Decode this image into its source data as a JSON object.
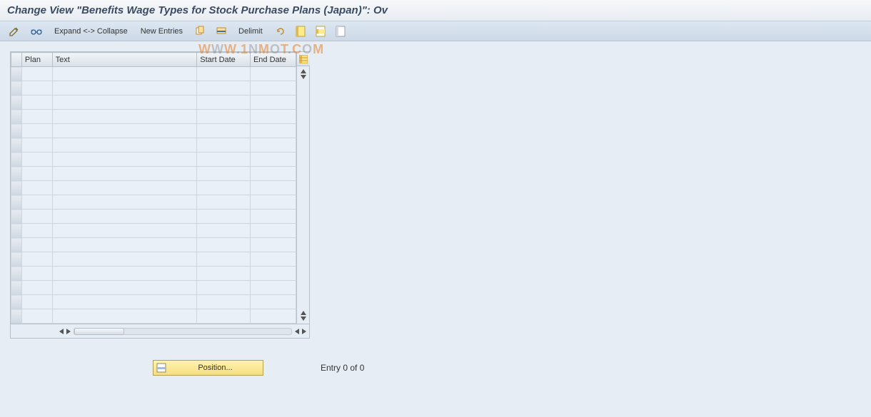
{
  "title": "Change View \"Benefits Wage Types for Stock Purchase Plans (Japan)\": Ov",
  "toolbar": {
    "expand_collapse": "Expand <-> Collapse",
    "new_entries": "New Entries",
    "delimit": "Delimit"
  },
  "columns": {
    "plan": "Plan",
    "text": "Text",
    "start_date": "Start Date",
    "end_date": "End Date"
  },
  "rows": [
    {
      "plan": "",
      "text": "",
      "start": "",
      "end": ""
    },
    {
      "plan": "",
      "text": "",
      "start": "",
      "end": ""
    },
    {
      "plan": "",
      "text": "",
      "start": "",
      "end": ""
    },
    {
      "plan": "",
      "text": "",
      "start": "",
      "end": ""
    },
    {
      "plan": "",
      "text": "",
      "start": "",
      "end": ""
    },
    {
      "plan": "",
      "text": "",
      "start": "",
      "end": ""
    },
    {
      "plan": "",
      "text": "",
      "start": "",
      "end": ""
    },
    {
      "plan": "",
      "text": "",
      "start": "",
      "end": ""
    },
    {
      "plan": "",
      "text": "",
      "start": "",
      "end": ""
    },
    {
      "plan": "",
      "text": "",
      "start": "",
      "end": ""
    },
    {
      "plan": "",
      "text": "",
      "start": "",
      "end": ""
    },
    {
      "plan": "",
      "text": "",
      "start": "",
      "end": ""
    },
    {
      "plan": "",
      "text": "",
      "start": "",
      "end": ""
    },
    {
      "plan": "",
      "text": "",
      "start": "",
      "end": ""
    },
    {
      "plan": "",
      "text": "",
      "start": "",
      "end": ""
    },
    {
      "plan": "",
      "text": "",
      "start": "",
      "end": ""
    },
    {
      "plan": "",
      "text": "",
      "start": "",
      "end": ""
    },
    {
      "plan": "",
      "text": "",
      "start": "",
      "end": ""
    }
  ],
  "position_button": "Position...",
  "entry_status": "Entry 0 of 0",
  "icons": {
    "toggle": "toggle-edit-icon",
    "other": "other-view-icon",
    "copy": "copy-icon",
    "delete": "delete-icon",
    "undo": "undo-icon",
    "select_all": "select-all-icon",
    "select_block": "select-block-icon",
    "deselect": "deselect-icon",
    "config": "table-settings-icon"
  },
  "watermark": "www.1nmot.com"
}
